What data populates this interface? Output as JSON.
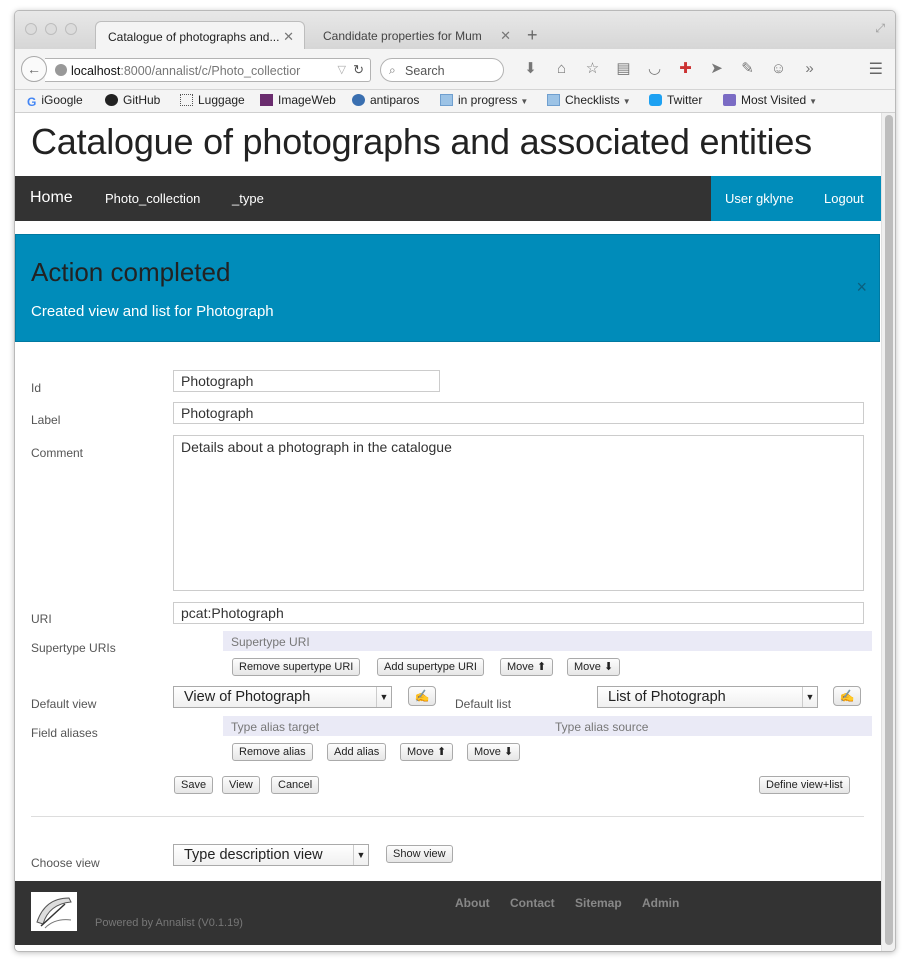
{
  "browser": {
    "tabs": [
      {
        "label": "Catalogue of photographs and...",
        "active": true
      },
      {
        "label": "Candidate properties for Mum",
        "active": false
      }
    ],
    "url": {
      "host": "localhost",
      "rest": ":8000/annalist/c/Photo_collectior"
    },
    "search_placeholder": "Search",
    "bookmarks": [
      {
        "label": "iGoogle",
        "icon": "google-icon"
      },
      {
        "label": "GitHub",
        "icon": "github-icon"
      },
      {
        "label": "Luggage",
        "icon": "dotted-square-icon"
      },
      {
        "label": "ImageWeb",
        "icon": "imageweb-icon"
      },
      {
        "label": "antiparos",
        "icon": "antiparos-icon"
      },
      {
        "label": "in progress",
        "icon": "folder-icon"
      },
      {
        "label": "Checklists",
        "icon": "folder-icon"
      },
      {
        "label": "Twitter",
        "icon": "twitter-icon"
      },
      {
        "label": "Most Visited",
        "icon": "most-visited-icon"
      }
    ]
  },
  "page": {
    "title": "Catalogue of photographs and associated entities",
    "nav": {
      "home": "Home",
      "collection": "Photo_collection",
      "type": "_type",
      "user": "User gklyne",
      "logout": "Logout"
    },
    "alert": {
      "heading": "Action completed",
      "message": "Created view and list for Photograph",
      "close": "×"
    },
    "form": {
      "id_label": "Id",
      "id_value": "Photograph",
      "label_label": "Label",
      "label_value": "Photograph",
      "comment_label": "Comment",
      "comment_value": "Details about a photograph in the catalogue",
      "uri_label": "URI",
      "uri_value": "pcat:Photograph",
      "supertype_label": "Supertype URIs",
      "supertype_header": "Supertype URI",
      "remove_supertype": "Remove supertype URI",
      "add_supertype": "Add supertype URI",
      "move_up": "Move ⬆",
      "move_down": "Move ⬇",
      "default_view_label": "Default view",
      "default_view_value": "View of Photograph",
      "default_list_label": "Default list",
      "default_list_value": "List of Photograph",
      "field_aliases_label": "Field aliases",
      "alias_target_header": "Type alias target",
      "alias_source_header": "Type alias source",
      "remove_alias": "Remove alias",
      "add_alias": "Add alias",
      "save": "Save",
      "view": "View",
      "cancel": "Cancel",
      "define_view_list": "Define view+list",
      "choose_view_label": "Choose view",
      "choose_view_value": "Type description view",
      "show_view": "Show view"
    },
    "footer": {
      "powered": "Powered by Annalist (V0.1.19)",
      "links": [
        "About",
        "Contact",
        "Sitemap",
        "Admin"
      ]
    }
  },
  "colors": {
    "accent": "#008cba",
    "nav": "#333333"
  }
}
